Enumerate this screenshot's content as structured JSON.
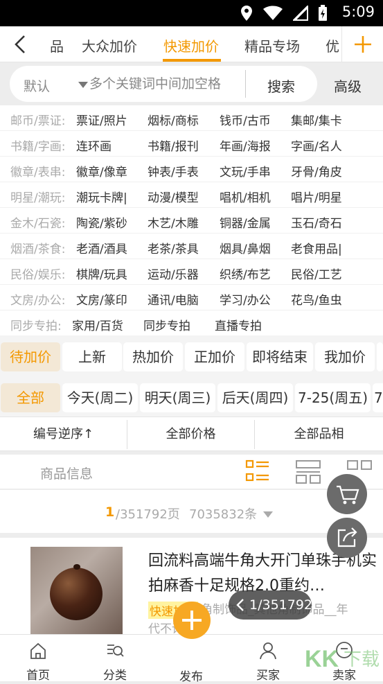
{
  "status": {
    "time": "5:09"
  },
  "nav": {
    "tabs": [
      {
        "label": "品"
      },
      {
        "label": "大众加价"
      },
      {
        "label": "快速加价"
      },
      {
        "label": "精品专场"
      },
      {
        "label": "优"
      }
    ],
    "active_tab": "快速加价"
  },
  "search": {
    "scope": "默认",
    "placeholder": "多个关键词中间加空格",
    "search_label": "搜索",
    "advanced_label": "高级"
  },
  "categories": [
    {
      "label": "邮币/票证:",
      "items": [
        "票证/照片",
        "烟标/商标",
        "钱币/古币",
        "集邮/集卡"
      ]
    },
    {
      "label": "书籍/字画:",
      "items": [
        "连环画",
        "书籍/报刊",
        "年画/海报",
        "字画/名人"
      ]
    },
    {
      "label": "徽章/表串:",
      "items": [
        "徽章/像章",
        "钟表/手表",
        "文玩/手串",
        "牙骨/角皮"
      ]
    },
    {
      "label": "明星/潮玩:",
      "items": [
        "潮玩卡牌|",
        "动漫/模型",
        "唱机/相机",
        "唱片/明星"
      ]
    },
    {
      "label": "金木/石瓷:",
      "items": [
        "陶瓷/紫砂",
        "木艺/木雕",
        "铜器/金属",
        "玉石/奇石"
      ]
    },
    {
      "label": "烟酒/茶食:",
      "items": [
        "老酒/酒具",
        "老茶/茶具",
        "烟具/鼻烟",
        "老食用品|"
      ]
    },
    {
      "label": "民俗/娱乐:",
      "items": [
        "棋牌/玩具",
        "运动/乐器",
        "织绣/布艺",
        "民俗/工艺"
      ]
    },
    {
      "label": "文房/办公:",
      "items": [
        "文房/篆印",
        "通讯/电脑",
        "学习/办公",
        "花鸟/鱼虫"
      ]
    },
    {
      "label": "同步专拍:",
      "items": [
        "家用/百货",
        "同步专拍",
        "直播专拍"
      ]
    }
  ],
  "status_filters": [
    "待加价",
    "上新",
    "热加价",
    "正加价",
    "即将结束",
    "我加价"
  ],
  "day_filters": [
    "全部",
    "今天(周二)",
    "明天(周三)",
    "后天(周四)",
    "7-25(周五)",
    "7"
  ],
  "sort": {
    "order_label": "编号逆序↑",
    "price_label": "全部价格",
    "quality_label": "全部品相"
  },
  "view": {
    "label": "商品信息"
  },
  "pagination": {
    "current": "1",
    "total_pages": "/351792页",
    "total_items": "7035832条",
    "overlay": "1/351792"
  },
  "product": {
    "title": "回流料高端牛角大开门单珠手机实拍麻香十足规格2.0重约…",
    "tag": "快速加价",
    "desc": "角制饰品_其他角制饰品__年",
    "desc2": "代不详"
  },
  "bottom_nav": {
    "home": "首页",
    "category": "分类",
    "publish": "发布",
    "buyer": "买家",
    "seller": "卖家"
  },
  "watermark": "KK下载",
  "colors": {
    "accent": "#f39800",
    "publish": "#f7a823"
  }
}
